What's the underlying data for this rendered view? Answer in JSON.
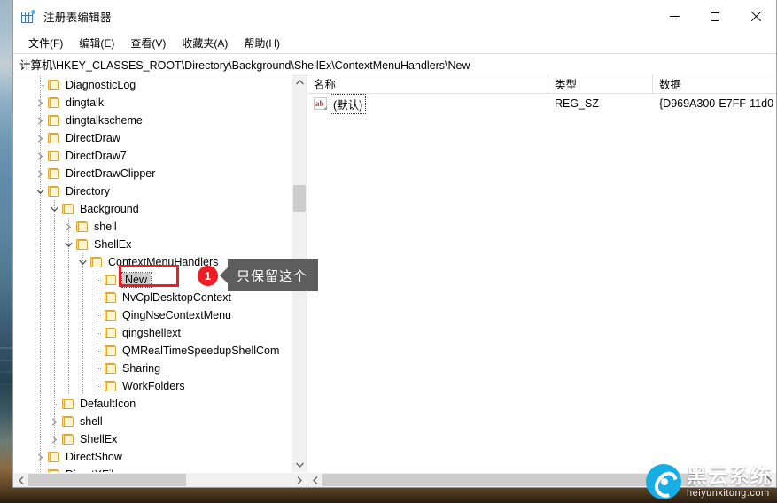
{
  "window": {
    "title": "注册表编辑器",
    "app_icon": "registry-icon",
    "controls": {
      "minimize": "minimize-icon",
      "maximize": "maximize-icon",
      "close": "close-icon"
    }
  },
  "menubar": {
    "items": [
      {
        "label": "文件(F)",
        "name": "menu-file"
      },
      {
        "label": "编辑(E)",
        "name": "menu-edit"
      },
      {
        "label": "查看(V)",
        "name": "menu-view"
      },
      {
        "label": "收藏夹(A)",
        "name": "menu-favorites"
      },
      {
        "label": "帮助(H)",
        "name": "menu-help"
      }
    ]
  },
  "address": {
    "path": "计算机\\HKEY_CLASSES_ROOT\\Directory\\Background\\ShellEx\\ContextMenuHandlers\\New"
  },
  "tree": {
    "nodes": [
      {
        "label": "DiagnosticLog",
        "indent": 1,
        "twist": "none",
        "selected": false
      },
      {
        "label": "dingtalk",
        "indent": 1,
        "twist": "collapsed",
        "selected": false
      },
      {
        "label": "dingtalkscheme",
        "indent": 1,
        "twist": "collapsed",
        "selected": false
      },
      {
        "label": "DirectDraw",
        "indent": 1,
        "twist": "collapsed",
        "selected": false
      },
      {
        "label": "DirectDraw7",
        "indent": 1,
        "twist": "collapsed",
        "selected": false
      },
      {
        "label": "DirectDrawClipper",
        "indent": 1,
        "twist": "collapsed",
        "selected": false
      },
      {
        "label": "Directory",
        "indent": 1,
        "twist": "expanded",
        "selected": false
      },
      {
        "label": "Background",
        "indent": 2,
        "twist": "expanded",
        "selected": false
      },
      {
        "label": "shell",
        "indent": 3,
        "twist": "collapsed",
        "selected": false
      },
      {
        "label": "ShellEx",
        "indent": 3,
        "twist": "expanded",
        "selected": false
      },
      {
        "label": "ContextMenuHandlers",
        "indent": 4,
        "twist": "expanded",
        "selected": false
      },
      {
        "label": "New",
        "indent": 5,
        "twist": "none",
        "selected": true
      },
      {
        "label": "NvCplDesktopContext",
        "indent": 5,
        "twist": "none",
        "selected": false
      },
      {
        "label": "QingNseContextMenu",
        "indent": 5,
        "twist": "none",
        "selected": false
      },
      {
        "label": "qingshellext",
        "indent": 5,
        "twist": "none",
        "selected": false
      },
      {
        "label": "QMRealTimeSpeedupShellCom",
        "indent": 5,
        "twist": "none",
        "selected": false
      },
      {
        "label": "Sharing",
        "indent": 5,
        "twist": "none",
        "selected": false
      },
      {
        "label": "WorkFolders",
        "indent": 5,
        "twist": "none",
        "selected": false
      },
      {
        "label": "DefaultIcon",
        "indent": 2,
        "twist": "none",
        "selected": false
      },
      {
        "label": "shell",
        "indent": 2,
        "twist": "collapsed",
        "selected": false
      },
      {
        "label": "ShellEx",
        "indent": 2,
        "twist": "collapsed",
        "selected": false
      },
      {
        "label": "DirectShow",
        "indent": 1,
        "twist": "collapsed",
        "selected": false
      },
      {
        "label": "DirectXFile",
        "indent": 1,
        "twist": "collapsed",
        "selected": false
      }
    ]
  },
  "list": {
    "columns": [
      "名称",
      "类型",
      "数据"
    ],
    "rows": [
      {
        "icon": "string-value-icon",
        "name": "(默认)",
        "type": "REG_SZ",
        "data": "{D969A300-E7FF-11d0"
      }
    ]
  },
  "annotation": {
    "badge": "1",
    "text": "只保留这个",
    "badge_color": "#ee1c25",
    "bubble_color": "#5d5d5d",
    "highlight_color": "#ee1c25"
  },
  "watermark": {
    "cn": "黑云系统",
    "en": "heiyunxitong.com",
    "logo_color": "#18aee5"
  }
}
